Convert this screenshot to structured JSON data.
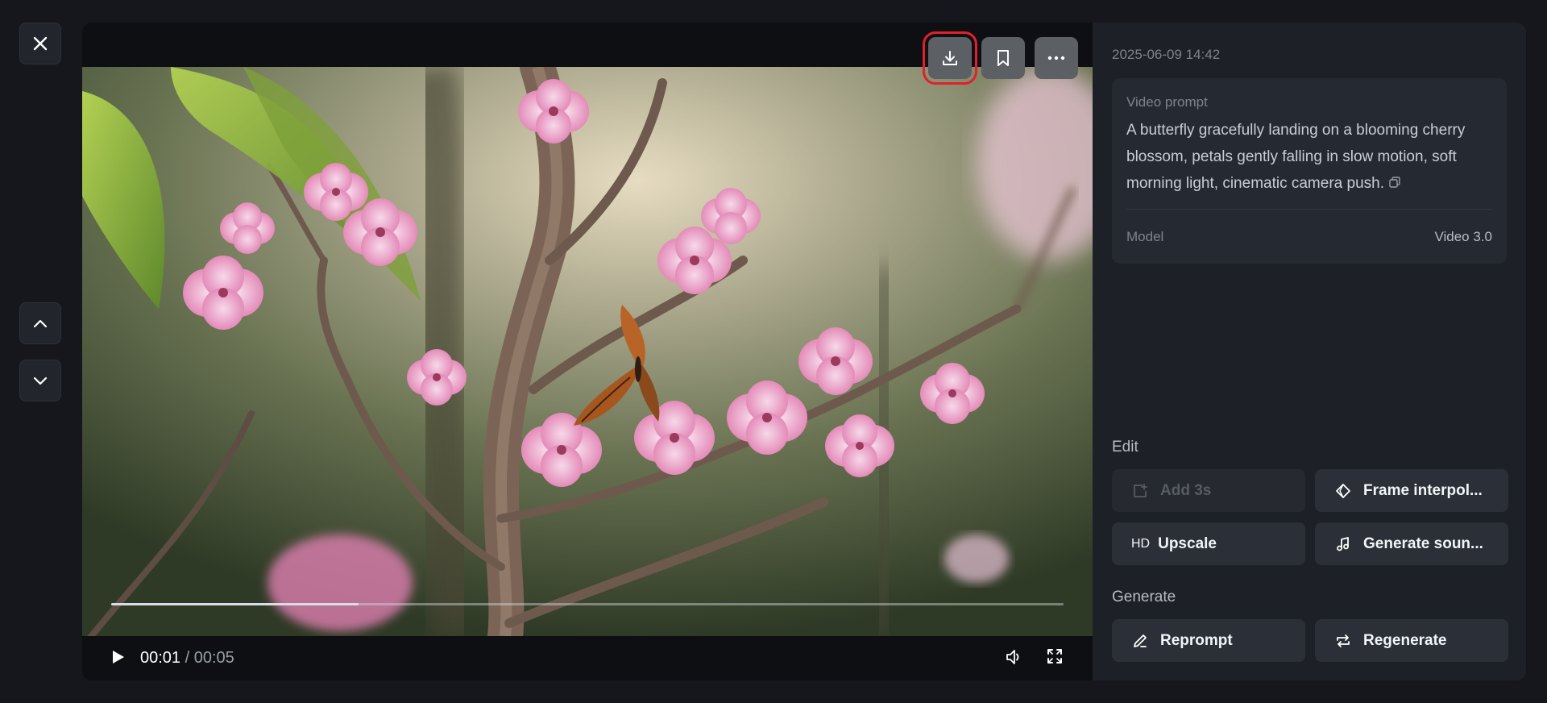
{
  "nav": {
    "close_icon": "close-icon",
    "prev_icon": "chevron-up-icon",
    "next_icon": "chevron-down-icon"
  },
  "video": {
    "actions": [
      {
        "name": "download",
        "icon": "download-icon",
        "highlighted": true
      },
      {
        "name": "bookmark",
        "icon": "bookmark-icon",
        "highlighted": false
      },
      {
        "name": "more",
        "icon": "more-icon",
        "highlighted": false
      }
    ],
    "current_time": "00:01",
    "separator": "/",
    "total_time": "00:05",
    "progress": 0.26
  },
  "details": {
    "date": "2025-06-09 14:42",
    "prompt_label": "Video prompt",
    "prompt_text": "A butterfly gracefully landing on a blooming cherry blossom, petals gently falling in slow motion, soft morning light, cinematic camera push.",
    "model_label": "Model",
    "model_value": "Video 3.0"
  },
  "edit": {
    "title": "Edit",
    "add3s_label": "Add 3s",
    "frame_label": "Frame interpol...",
    "upscale_prefix": "HD",
    "upscale_label": "Upscale",
    "sound_label": "Generate soun..."
  },
  "generate": {
    "title": "Generate",
    "reprompt_label": "Reprompt",
    "regenerate_label": "Regenerate"
  },
  "colors": {
    "background": "#15171c",
    "panel": "#1d2027",
    "highlight": "#e0202c"
  }
}
